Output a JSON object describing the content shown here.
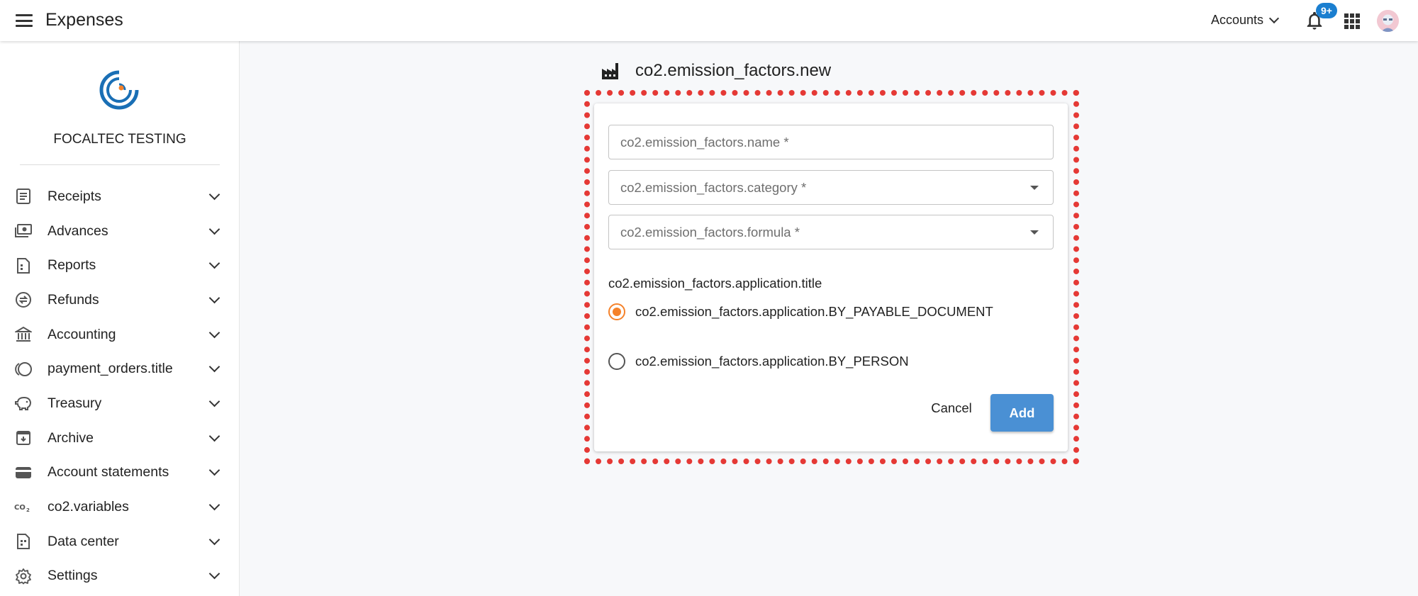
{
  "header": {
    "app_title": "Expenses",
    "accounts_label": "Accounts",
    "notification_badge": "9+"
  },
  "sidebar": {
    "org_name": "FOCALTEC TESTING",
    "items": [
      {
        "label": "Receipts",
        "icon": "receipt-icon"
      },
      {
        "label": "Advances",
        "icon": "cash-icon"
      },
      {
        "label": "Reports",
        "icon": "report-icon"
      },
      {
        "label": "Refunds",
        "icon": "refund-icon"
      },
      {
        "label": "Accounting",
        "icon": "bank-icon"
      },
      {
        "label": "payment_orders.title",
        "icon": "coins-icon"
      },
      {
        "label": "Treasury",
        "icon": "piggy-bank-icon"
      },
      {
        "label": "Archive",
        "icon": "archive-icon"
      },
      {
        "label": "Account statements",
        "icon": "wallet-icon"
      },
      {
        "label": "co2.variables",
        "icon": "co2-icon"
      },
      {
        "label": "Data center",
        "icon": "data-center-icon"
      },
      {
        "label": "Settings",
        "icon": "gear-icon"
      }
    ]
  },
  "form": {
    "page_title": "co2.emission_factors.new",
    "name_placeholder": "co2.emission_factors.name *",
    "category_label": "co2.emission_factors.category *",
    "formula_label": "co2.emission_factors.formula *",
    "application_title": "co2.emission_factors.application.title",
    "options": [
      {
        "label": "co2.emission_factors.application.BY_PAYABLE_DOCUMENT",
        "selected": true
      },
      {
        "label": "co2.emission_factors.application.BY_PERSON",
        "selected": false
      }
    ],
    "cancel_label": "Cancel",
    "add_label": "Add"
  },
  "colors": {
    "accent": "#f5822a",
    "primary_button": "#4a90d4",
    "badge": "#1b7fd0",
    "highlight_border": "#e53935"
  }
}
